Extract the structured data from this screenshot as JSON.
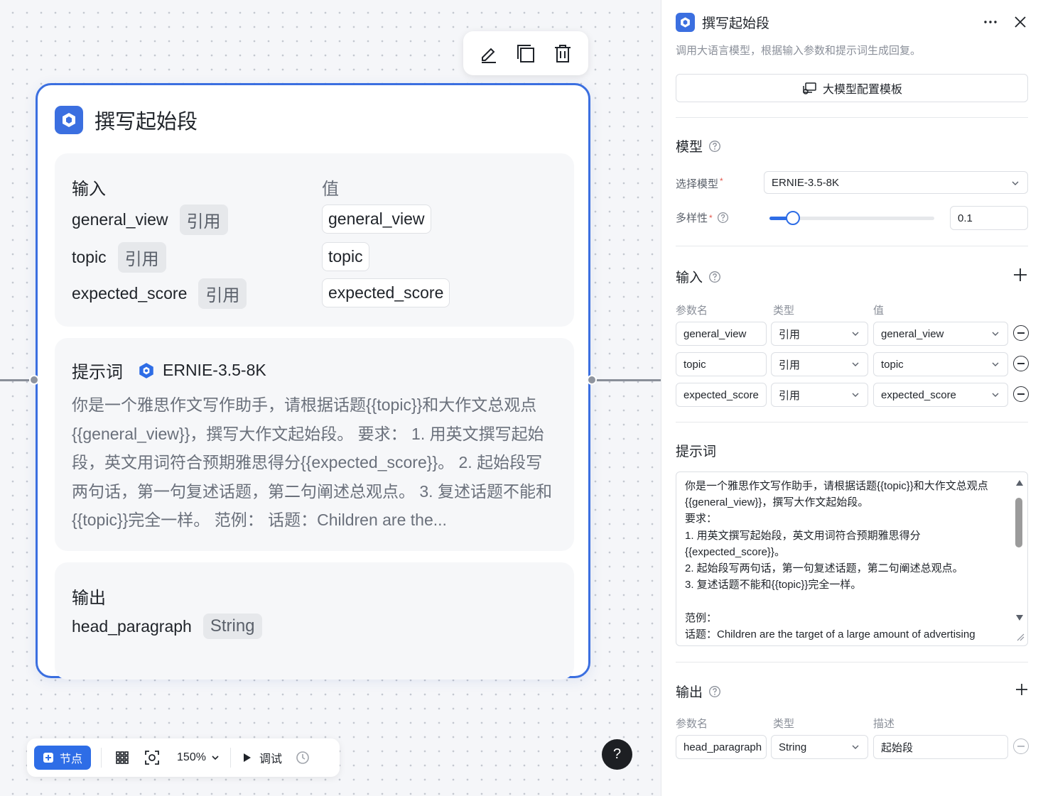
{
  "node": {
    "title": "撰写起始段",
    "input_section": {
      "label": "输入",
      "value_header": "值",
      "rows": [
        {
          "name": "general_view",
          "type": "引用",
          "value": "general_view"
        },
        {
          "name": "topic",
          "type": "引用",
          "value": "topic"
        },
        {
          "name": "expected_score",
          "type": "引用",
          "value": "expected_score"
        }
      ]
    },
    "prompt_section": {
      "label": "提示词",
      "model": "ERNIE-3.5-8K",
      "text": "你是一个雅思作文写作助手，请根据话题{{topic}}和大作文总观点{{general_view}}，撰写大作文起始段。 要求： 1. 用英文撰写起始段，英文用词符合预期雅思得分{{expected_score}}。 2. 起始段写两句话，第一句复述话题，第二句阐述总观点。 3. 复述话题不能和{{topic}}完全一样。 范例： 话题：Children are the..."
    },
    "output_section": {
      "label": "输出",
      "name": "head_paragraph",
      "type": "String"
    }
  },
  "bottom_bar": {
    "add_node_label": "节点",
    "zoom": "150%",
    "debug_label": "调试",
    "help_label": "?"
  },
  "panel": {
    "title": "撰写起始段",
    "description": "调用大语言模型，根据输入参数和提示词生成回复。",
    "template_button": "大模型配置模板",
    "model_section": {
      "title": "模型",
      "select_label": "选择模型",
      "selected_model": "ERNIE-3.5-8K",
      "diversity_label": "多样性",
      "diversity_value": "0.1",
      "diversity_fraction": 0.1
    },
    "input_section": {
      "title": "输入",
      "col_name": "参数名",
      "col_type": "类型",
      "col_value": "值",
      "rows": [
        {
          "name": "general_view",
          "type": "引用",
          "value": "general_view"
        },
        {
          "name": "topic",
          "type": "引用",
          "value": "topic"
        },
        {
          "name": "expected_score",
          "type": "引用",
          "value": "expected_score"
        }
      ]
    },
    "prompt_section": {
      "title": "提示词",
      "text": "你是一个雅思作文写作助手，请根据话题{{topic}}和大作文总观点{{general_view}}，撰写大作文起始段。\n要求：\n1. 用英文撰写起始段，英文用词符合预期雅思得分{{expected_score}}。\n2. 起始段写两句话，第一句复述话题，第二句阐述总观点。\n3. 复述话题不能和{{topic}}完全一样。\n\n范例：\n话题：Children are the target of a large amount of advertising"
    },
    "output_section": {
      "title": "输出",
      "col_name": "参数名",
      "col_type": "类型",
      "col_desc": "描述",
      "row": {
        "name": "head_paragraph",
        "type": "String",
        "desc": "起始段"
      }
    }
  },
  "colors": {
    "accent": "#3b6fe0",
    "node_button": "#2e6de6"
  }
}
